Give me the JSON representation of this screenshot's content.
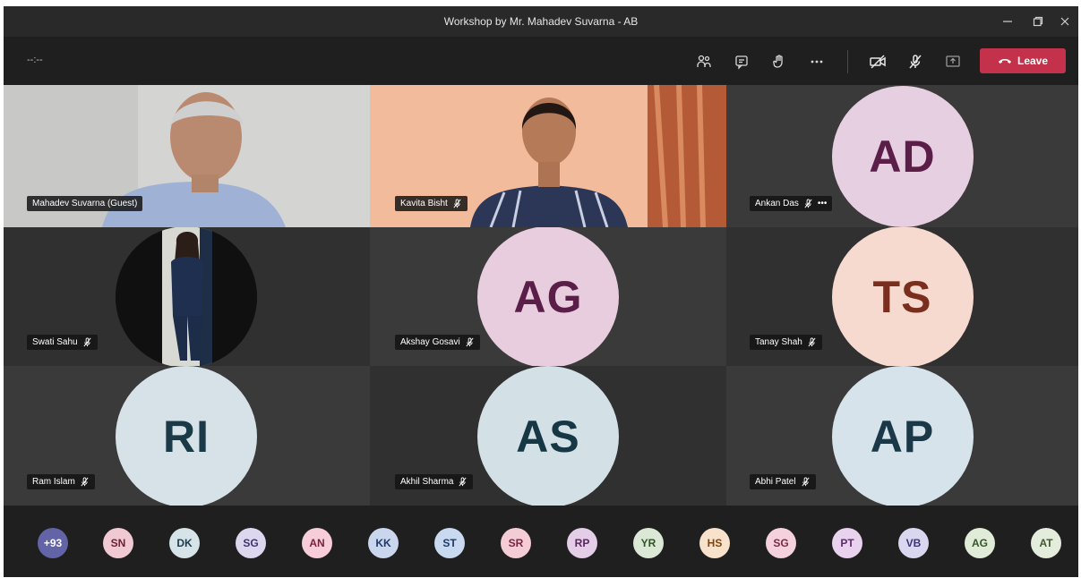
{
  "window": {
    "title": "Workshop by Mr. Mahadev Suvarna - AB"
  },
  "toolbar": {
    "timer": "--:--",
    "leave_label": "Leave"
  },
  "tiles": [
    {
      "name": "Mahadev Suvarna (Guest)",
      "type": "video",
      "muted": false
    },
    {
      "name": "Kavita Bisht",
      "type": "video",
      "muted": true
    },
    {
      "name": "Ankan Das",
      "type": "avatar",
      "initials": "AD",
      "bg": "#e6cfe0",
      "fg": "#5a1e48",
      "muted": true,
      "more": "•••"
    },
    {
      "name": "Swati Sahu",
      "type": "photo",
      "muted": true
    },
    {
      "name": "Akshay Gosavi",
      "type": "avatar",
      "initials": "AG",
      "bg": "#e8cddf",
      "fg": "#5a1e48",
      "muted": true
    },
    {
      "name": "Tanay Shah",
      "type": "avatar",
      "initials": "TS",
      "bg": "#f6d9cf",
      "fg": "#7a2e1d",
      "muted": true
    },
    {
      "name": "Ram Islam",
      "type": "avatar",
      "initials": "RI",
      "bg": "#d7e2e8",
      "fg": "#1b3a48",
      "muted": true
    },
    {
      "name": "Akhil Sharma",
      "type": "avatar",
      "initials": "AS",
      "bg": "#d3e0e6",
      "fg": "#163744",
      "muted": true
    },
    {
      "name": "Abhi Patel",
      "type": "avatar",
      "initials": "AP",
      "bg": "#d7e3ea",
      "fg": "#1a3847",
      "muted": true
    }
  ],
  "roster": [
    {
      "initials": "+93",
      "bg": "#6264a7",
      "fg": "#ffffff"
    },
    {
      "initials": "SN",
      "bg": "#f0c9d2",
      "fg": "#6a2236"
    },
    {
      "initials": "DK",
      "bg": "#d6e4ea",
      "fg": "#1d3c4a"
    },
    {
      "initials": "SG",
      "bg": "#dcd7ee",
      "fg": "#3f3470"
    },
    {
      "initials": "AN",
      "bg": "#f6cdd8",
      "fg": "#7a2140"
    },
    {
      "initials": "KK",
      "bg": "#c9d6ee",
      "fg": "#203a6a"
    },
    {
      "initials": "ST",
      "bg": "#c9d9f0",
      "fg": "#1e3a66"
    },
    {
      "initials": "SR",
      "bg": "#f3ccd6",
      "fg": "#7b2340"
    },
    {
      "initials": "RP",
      "bg": "#e4cde6",
      "fg": "#5b2661"
    },
    {
      "initials": "YR",
      "bg": "#dbe8d5",
      "fg": "#2d5424"
    },
    {
      "initials": "HS",
      "bg": "#f8e2cc",
      "fg": "#7a4614"
    },
    {
      "initials": "SG",
      "bg": "#f4d1dc",
      "fg": "#7a2a45"
    },
    {
      "initials": "PT",
      "bg": "#e9d2ee",
      "fg": "#5f2a6b"
    },
    {
      "initials": "VB",
      "bg": "#d9d6f0",
      "fg": "#3a3474"
    },
    {
      "initials": "AG",
      "bg": "#e1ecd8",
      "fg": "#35552a"
    },
    {
      "initials": "AT",
      "bg": "#e4ecdc",
      "fg": "#3e5830"
    }
  ]
}
